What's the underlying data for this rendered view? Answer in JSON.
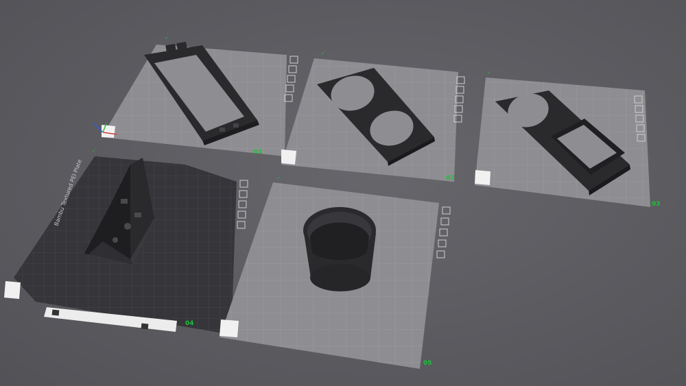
{
  "app": {
    "accent_color": "#1fbf3a",
    "background_color": "#5c5c61",
    "plate_color": "#8e8e92",
    "textured_plate_color": "#35353a",
    "model_color": "#2a2a2d"
  },
  "plates": [
    {
      "index": "01",
      "label": "01",
      "surface": "default",
      "model": "rectangular frame"
    },
    {
      "index": "02",
      "label": "02",
      "surface": "default",
      "model": "plate with two circular openings"
    },
    {
      "index": "03",
      "label": "03",
      "surface": "default",
      "model": "plate with circular opening and rectangular pocket"
    },
    {
      "index": "04",
      "label": "04",
      "surface": "textured",
      "model": "angled bracket",
      "bed_text": "Bambu Textured PEI Plate"
    },
    {
      "index": "05",
      "label": "05",
      "surface": "default",
      "model": "cylindrical cup"
    }
  ],
  "plate_controls": [
    "close-icon",
    "settings-icon",
    "arrange-icon",
    "lock-icon",
    "orient-icon"
  ],
  "axes": {
    "x_color": "#d9383a",
    "y_color": "#2fbf3a",
    "z_color": "#3a5ad9"
  }
}
